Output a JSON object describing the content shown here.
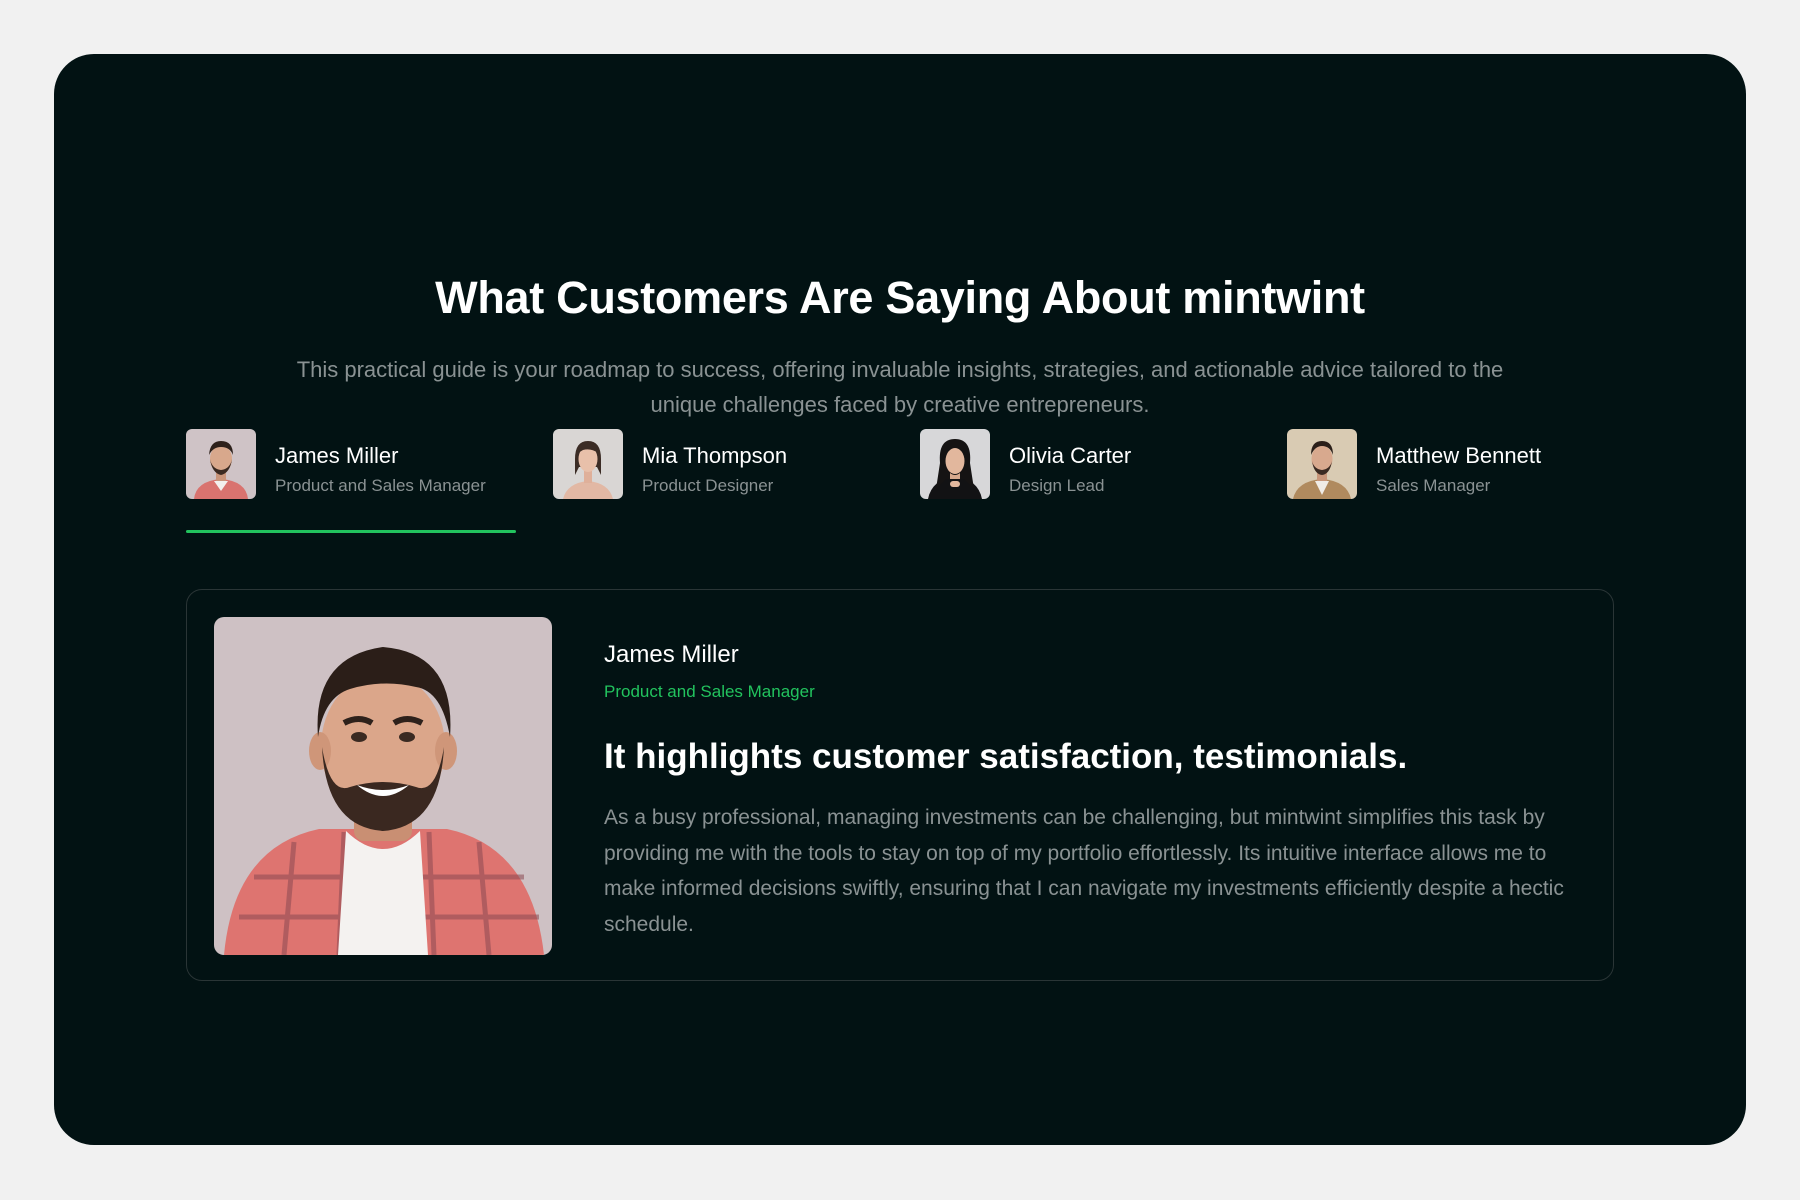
{
  "section": {
    "title": "What Customers Are Saying About mintwint",
    "subtitle": "This practical guide is your roadmap to success, offering invaluable insights, strategies, and actionable advice tailored to the unique challenges faced by creative entrepreneurs."
  },
  "tabs": [
    {
      "name": "James Miller",
      "role": "Product and Sales Manager",
      "active": true
    },
    {
      "name": "Mia Thompson",
      "role": "Product Designer",
      "active": false
    },
    {
      "name": "Olivia Carter",
      "role": "Design Lead",
      "active": false
    },
    {
      "name": "Matthew Bennett",
      "role": "Sales Manager",
      "active": false
    }
  ],
  "testimonial": {
    "name": "James Miller",
    "role": "Product and Sales Manager",
    "headline": "It highlights customer satisfaction, testimonials.",
    "body": "As a busy professional, managing investments can be challenging, but mintwint simplifies this task by providing me with the tools to stay on top of my portfolio effortlessly. Its intuitive interface allows me to make informed decisions swiftly, ensuring that I can navigate my investments efficiently despite a hectic schedule."
  },
  "colors": {
    "background": "#021213",
    "accent": "#22c35e",
    "muted_text": "#8a9293",
    "page": "#f1f1f1"
  }
}
